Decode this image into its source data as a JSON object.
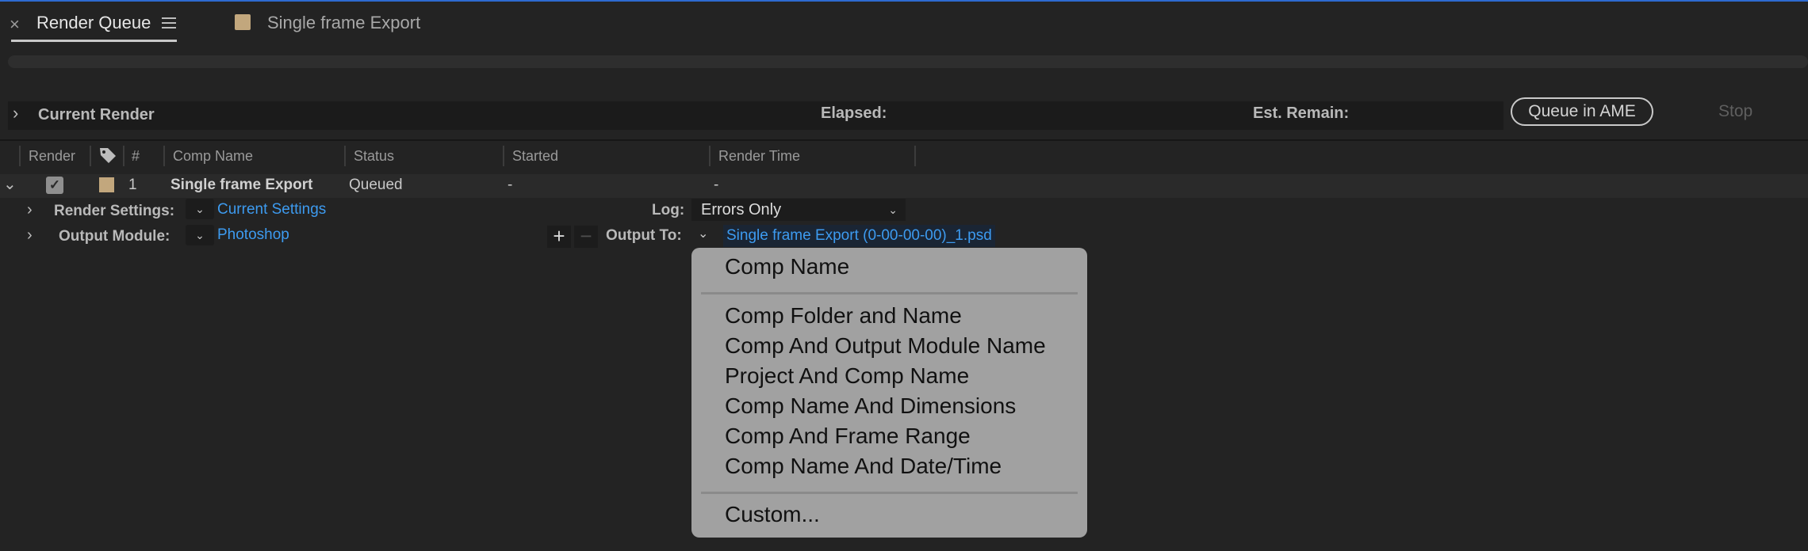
{
  "tabs": [
    {
      "label": "Render Queue",
      "close": "×"
    },
    {
      "label": "Single frame Export"
    }
  ],
  "current_render": {
    "label": "Current Render",
    "elapsed_label": "Elapsed:",
    "remain_label": "Est. Remain:",
    "queue_ame_label": "Queue in AME",
    "stop_label": "Stop"
  },
  "columns": [
    "Render",
    "#",
    "Comp Name",
    "Status",
    "Started",
    "Render Time"
  ],
  "row": {
    "number": "1",
    "comp_name": "Single frame Export",
    "status": "Queued",
    "started": "-",
    "render_time": "-"
  },
  "render_settings": {
    "label": "Render Settings:",
    "value": "Current Settings"
  },
  "log": {
    "label": "Log:",
    "value": "Errors Only"
  },
  "output_module": {
    "label": "Output Module:",
    "value": "Photoshop"
  },
  "output_to": {
    "label": "Output To:",
    "file": "Single frame Export (0-00-00-00)_1.psd"
  },
  "dropdown_menu": {
    "items": [
      "Comp Name",
      "Comp Folder and Name",
      "Comp And Output Module Name",
      "Project And Comp Name",
      "Comp Name And Dimensions",
      "Comp And Frame Range",
      "Comp Name And Date/Time",
      "Custom..."
    ]
  },
  "colors": {
    "accent_blue": "#3d9bf0",
    "label_swatch": "#c2a77d",
    "top_line": "#2d6ad1"
  },
  "icons": [
    "close-icon",
    "hamburger-menu-icon",
    "chevron-right-icon",
    "chevron-down-icon",
    "tag-icon",
    "checkbox-icon",
    "plus-icon",
    "minus-icon"
  ]
}
